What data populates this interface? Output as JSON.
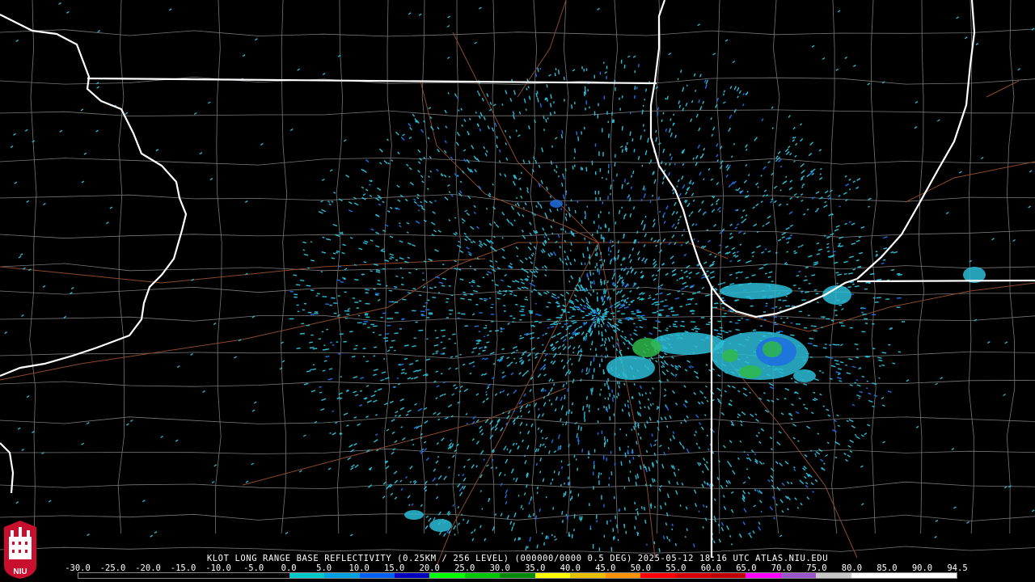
{
  "caption": "KLOT LONG RANGE BASE REFLECTIVITY (0.25KM / 256 LEVEL) (000000/0000 0.5 DEG) 2025-05-12 18:16 UTC  ATLAS.NIU.EDU",
  "logo_text": "NIU",
  "scale": {
    "labels": [
      "-30.0",
      "-25.0",
      "-20.0",
      "-15.0",
      "-10.0",
      "-5.0",
      "0.0",
      "5.0",
      "10.0",
      "15.0",
      "20.0",
      "25.0",
      "30.0",
      "35.0",
      "40.0",
      "45.0",
      "50.0",
      "55.0",
      "60.0",
      "65.0",
      "70.0",
      "75.0",
      "80.0",
      "85.0",
      "90.0",
      "94.5"
    ],
    "colors": [
      "#000000",
      "#000000",
      "#000000",
      "#000000",
      "#000000",
      "#000000",
      "#00c8c8",
      "#00a0e0",
      "#0060f0",
      "#0000c0",
      "#00ff00",
      "#00c800",
      "#008c00",
      "#ffff00",
      "#e6c000",
      "#ff9000",
      "#ff0000",
      "#d60000",
      "#c00000",
      "#ff00ff",
      "#9955c9",
      "#c8c8c8",
      "#ffffff",
      "#ffffff",
      "#ffffff"
    ]
  },
  "colors": {
    "state_line": "#ffffff",
    "county_line": "#777777",
    "road": "#8b4a2b",
    "echo_light": "#2bbcd6",
    "echo_blue": "#1f6fe0",
    "echo_green": "#2fb84a"
  }
}
